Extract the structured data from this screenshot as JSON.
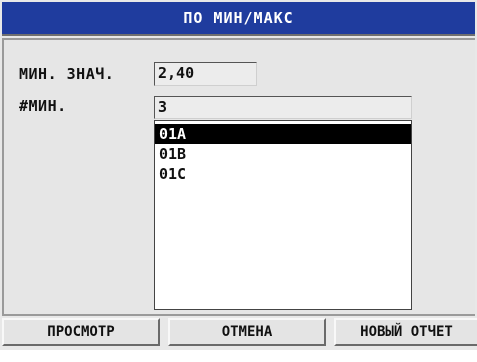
{
  "title": "ПО МИН/МАКС",
  "fields": {
    "min_value": {
      "label": "МИН. ЗНАЧ.",
      "value": "2,40"
    },
    "min_count": {
      "label": "#МИН.",
      "value": "3"
    }
  },
  "locations": [
    "01A",
    "01B",
    "01C"
  ],
  "selected_index": 0,
  "softkeys": [
    "ПРОСМОТР",
    "ОТМЕНА",
    "НОВЫЙ ОТЧЕТ"
  ],
  "colors": {
    "title_bar": "#1f3c9e",
    "selection": "#000000"
  }
}
